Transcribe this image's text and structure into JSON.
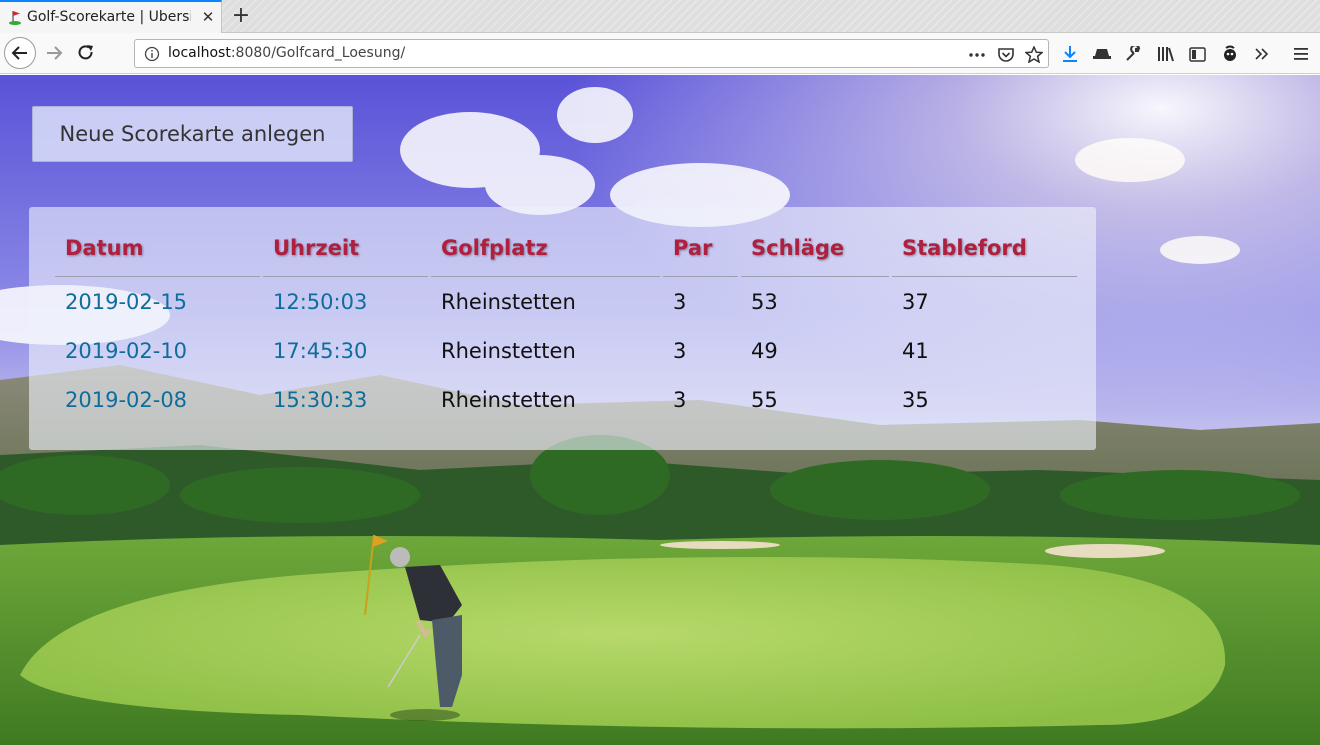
{
  "browser": {
    "tab_title": "Golf-Scorekarte | Übersicht",
    "url_host": "localhost",
    "url_rest": ":8080/Golfcard_Loesung/"
  },
  "page": {
    "new_button_label": "Neue Scorekarte anlegen",
    "table": {
      "headers": [
        "Datum",
        "Uhrzeit",
        "Golfplatz",
        "Par",
        "Schläge",
        "Stableford"
      ],
      "rows": [
        [
          "2019-02-15",
          "12:50:03",
          "Rheinstetten",
          "3",
          "53",
          "37"
        ],
        [
          "2019-02-10",
          "17:45:30",
          "Rheinstetten",
          "3",
          "49",
          "41"
        ],
        [
          "2019-02-08",
          "15:30:33",
          "Rheinstetten",
          "3",
          "55",
          "35"
        ]
      ]
    }
  },
  "colors": {
    "header_text": "#b11f3e",
    "link_text": "#0f6d9c",
    "accent": "#0a84ff"
  },
  "icons": [
    "golf-flag-favicon",
    "close-icon",
    "plus-icon",
    "back-arrow-icon",
    "forward-arrow-icon",
    "reload-icon",
    "info-icon",
    "ellipsis-icon",
    "pocket-icon",
    "star-icon",
    "download-icon",
    "hat-icon",
    "wrench-icon",
    "library-icon",
    "sidebar-icon",
    "extension-icon",
    "overflow-icon",
    "hamburger-menu-icon"
  ]
}
